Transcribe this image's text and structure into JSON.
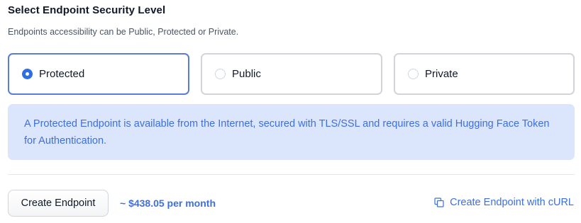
{
  "header": {
    "title": "Select Endpoint Security Level",
    "subtitle": "Endpoints accessibility can be Public, Protected or Private."
  },
  "security_options": [
    {
      "label": "Protected",
      "selected": true
    },
    {
      "label": "Public",
      "selected": false
    },
    {
      "label": "Private",
      "selected": false
    }
  ],
  "info": {
    "text": "A Protected Endpoint is available from the Internet, secured with TLS/SSL and requires a valid Hugging Face Token for Authentication."
  },
  "footer": {
    "create_button_label": "Create Endpoint",
    "price": "~ $438.05 per month",
    "curl_link_label": "Create Endpoint with cURL",
    "curl_icon": "copy-icon"
  },
  "colors": {
    "accent": "#3d6fe0",
    "selected_border": "#5b7bd6",
    "info_background": "#dbe6fc"
  }
}
